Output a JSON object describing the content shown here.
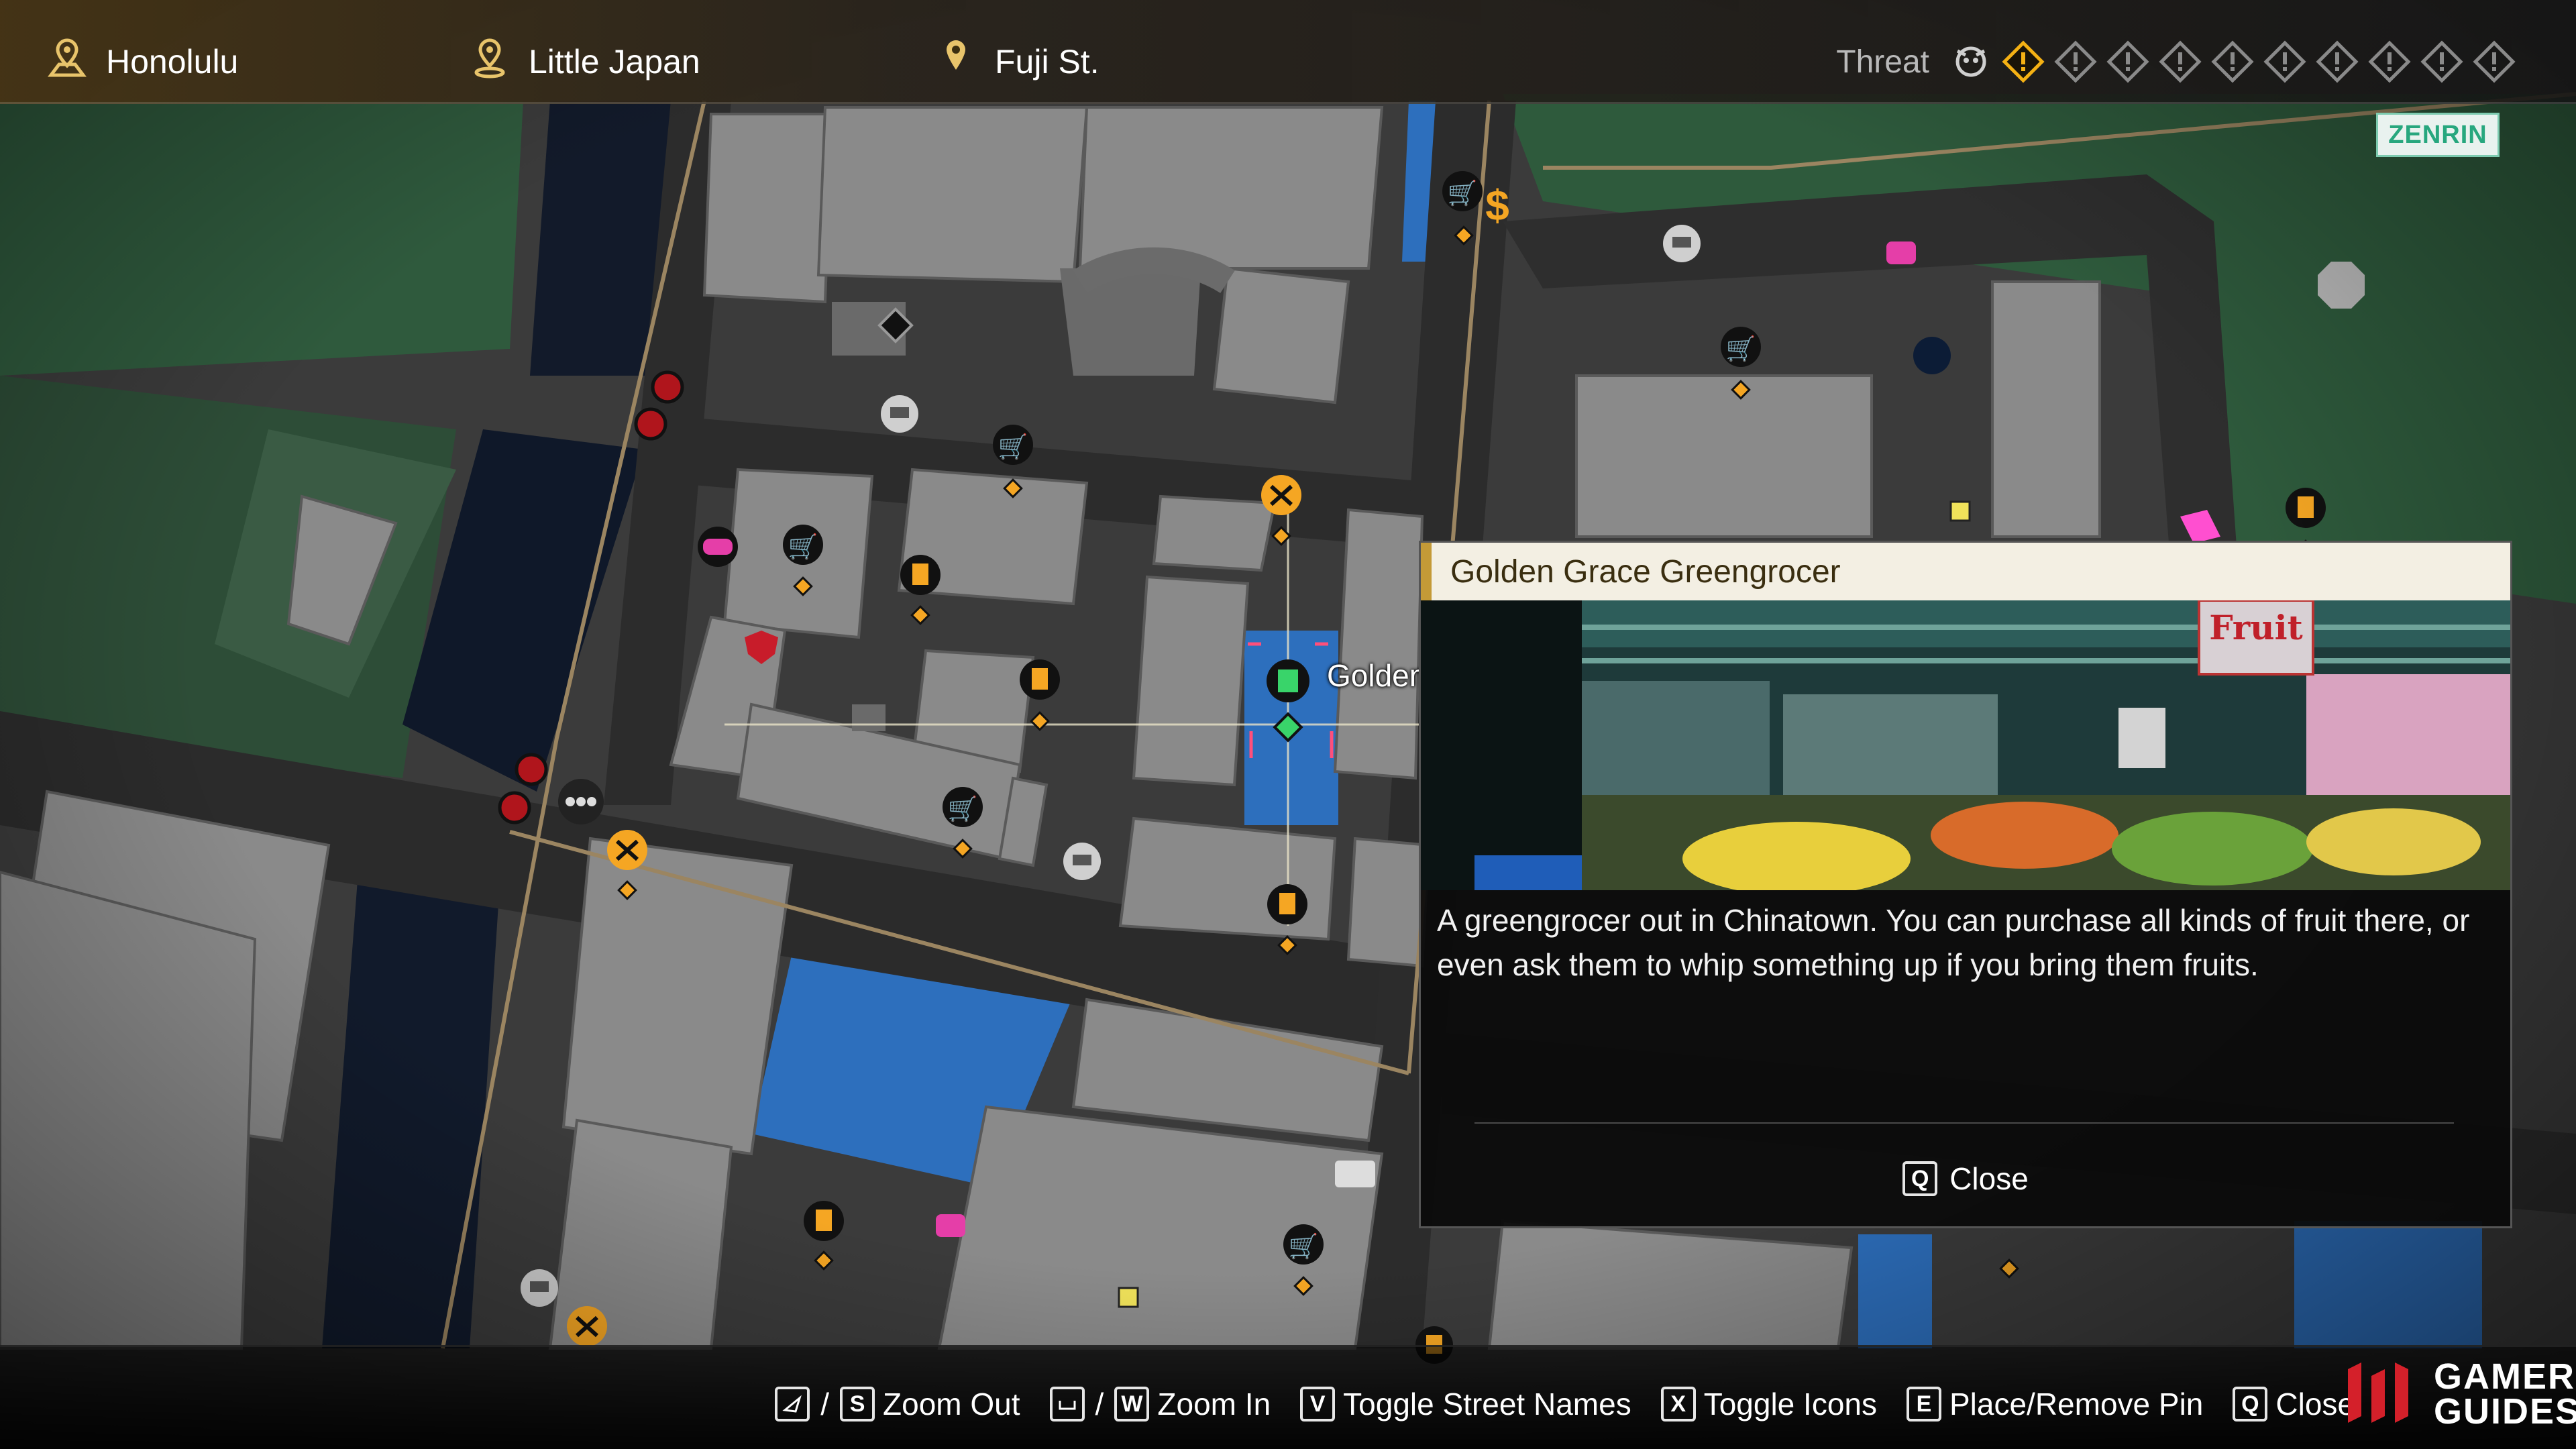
{
  "header": {
    "locations": [
      {
        "icon": "city-pin-icon",
        "label": "Honolulu"
      },
      {
        "icon": "district-pin-icon",
        "label": "Little Japan"
      },
      {
        "icon": "street-pin-icon",
        "label": "Fuji St."
      }
    ],
    "threat": {
      "label": "Threat",
      "level": 1,
      "max": 10
    },
    "colors": {
      "accent": "#c49a37",
      "threat_active": "#f5b114"
    }
  },
  "map": {
    "zenrin_label": "ZENRIN",
    "selected_label": "Golden"
  },
  "panel": {
    "title": "Golden Grace Greengrocer",
    "photo_sign": "Fruit",
    "description": "A greengrocer out in Chinatown. You can purchase all kinds of fruit there, or even ask them to whip something up if you bring them fruits.",
    "close_key": "Q",
    "close_label": "Close"
  },
  "controls": {
    "zoom_out_key": "S",
    "zoom_out_label": "Zoom Out",
    "zoom_in_key": "W",
    "zoom_in_label": "Zoom In",
    "street_key": "V",
    "street_label": "Toggle Street Names",
    "icons_key": "X",
    "icons_label": "Toggle Icons",
    "pin_key": "E",
    "pin_label": "Place/Remove Pin",
    "close_key": "Q",
    "close_label": "Close"
  },
  "watermark": {
    "line1": "GAMER",
    "line2": "GUIDES"
  }
}
